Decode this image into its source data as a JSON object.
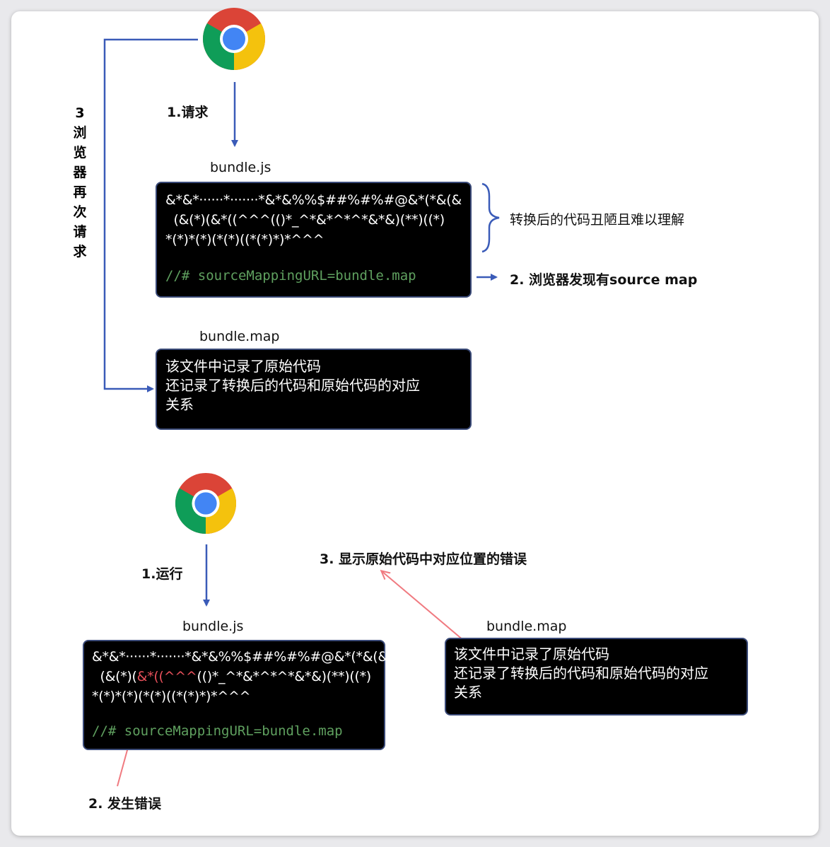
{
  "top": {
    "label_request": "1.请求",
    "side_label": "3",
    "side_chars": [
      "浏",
      "览",
      "器",
      "再",
      "次",
      "请",
      "求"
    ],
    "bundle_js_label": "bundle.js",
    "code_lines": [
      "&*&*······*·······*&*&%%$##%#%#@&*(*&(&",
      "  (&(*)(&*((^^^(()*_^*&*^*^*&*&)(**)((*)",
      "*(*)*(*)(*(*)((*(*)*)*^^^"
    ],
    "source_mapping": "//# sourceMappingURL=bundle.map",
    "brace_note": "转换后的代码丑陋且难以理解",
    "found_note": "2. 浏览器发现有source map",
    "bundle_map_label": "bundle.map",
    "map_lines": [
      "该文件中记录了原始代码",
      "还记录了转换后的代码和原始代码的对应",
      "关系"
    ]
  },
  "bottom": {
    "label_run": "1.运行",
    "bundle_js_label": "bundle.js",
    "code_line1": "&*&*······*·······*&*&%%$##%#%#@&*(*&(&",
    "code_line2_pre": "  (&(*)(",
    "code_line2_red": "&*((^^^",
    "code_line2_post": "(()*_^*&*^*^*&*&)(**)((*)",
    "code_line3": "*(*)*(*)(*(*)((*(*)*)*^^^",
    "source_mapping": "//# sourceMappingURL=bundle.map",
    "error_note": "2. 发生错误",
    "show_note": "3. 显示原始代码中对应位置的错误",
    "bundle_map_label": "bundle.map",
    "map_lines": [
      "该文件中记录了原始代码",
      "还记录了转换后的代码和原始代码的对应",
      "关系"
    ]
  },
  "colors": {
    "arrow_blue": "#3a5bb8",
    "arrow_red": "#f07a80",
    "code_green": "#5fa05f",
    "highlight_red": "#e8505b"
  },
  "icons": [
    "chrome-icon"
  ]
}
